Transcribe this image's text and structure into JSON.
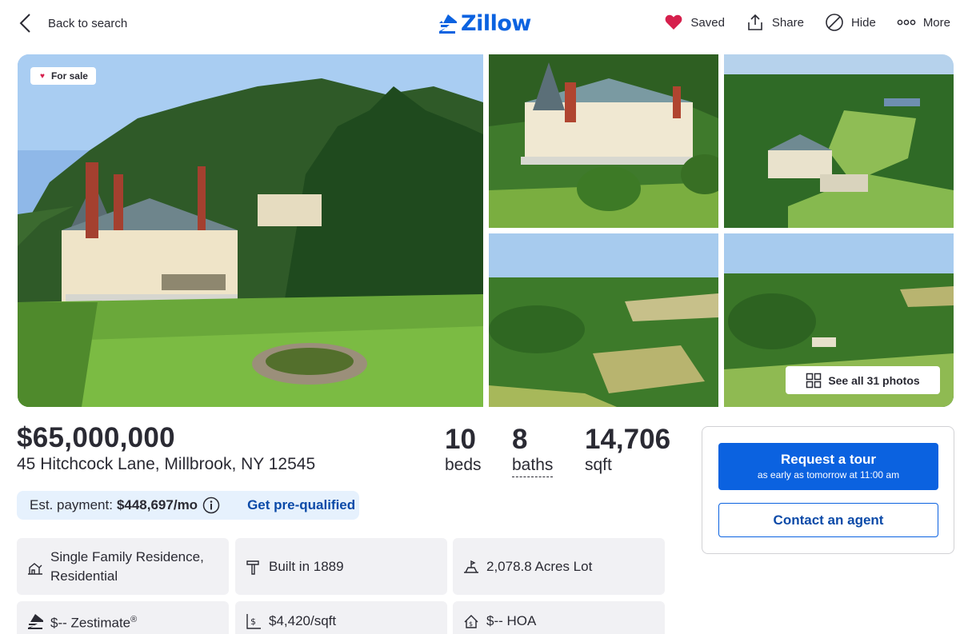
{
  "header": {
    "back_label": "Back to search",
    "logo_text": "Zillow",
    "brand_color": "#0b62e0",
    "actions": [
      {
        "label": "Saved",
        "icon": "heart-filled-icon"
      },
      {
        "label": "Share",
        "icon": "share-icon"
      },
      {
        "label": "Hide",
        "icon": "hide-icon"
      },
      {
        "label": "More",
        "icon": "more-icon"
      }
    ]
  },
  "gallery": {
    "status_badge": "For sale",
    "see_all_label": "See all 31 photos"
  },
  "listing": {
    "price": "$65,000,000",
    "address": "45 Hitchcock Lane, Millbrook, NY 12545",
    "beds": {
      "value": "10",
      "label": "beds"
    },
    "baths": {
      "value": "8",
      "label": "baths"
    },
    "sqft": {
      "value": "14,706",
      "label": "sqft"
    }
  },
  "payment": {
    "label": "Est. payment:",
    "amount": "$448,697/mo",
    "prequal_label": "Get pre-qualified"
  },
  "facts": [
    {
      "text": "Single Family Residence, Residential",
      "icon": "home-type-icon"
    },
    {
      "text": "Built in 1889",
      "icon": "hammer-icon"
    },
    {
      "text": "2,078.8 Acres Lot",
      "icon": "lot-size-icon"
    },
    {
      "text": "$-- Zestimate",
      "sup": "®",
      "icon": "zestimate-icon"
    },
    {
      "text": "$4,420/sqft",
      "icon": "price-per-sqft-icon"
    },
    {
      "text": "$-- HOA",
      "icon": "hoa-icon"
    }
  ],
  "agent_card": {
    "tour_label": "Request a tour",
    "tour_sub": "as early as tomorrow at 11:00 am",
    "contact_label": "Contact an agent"
  }
}
